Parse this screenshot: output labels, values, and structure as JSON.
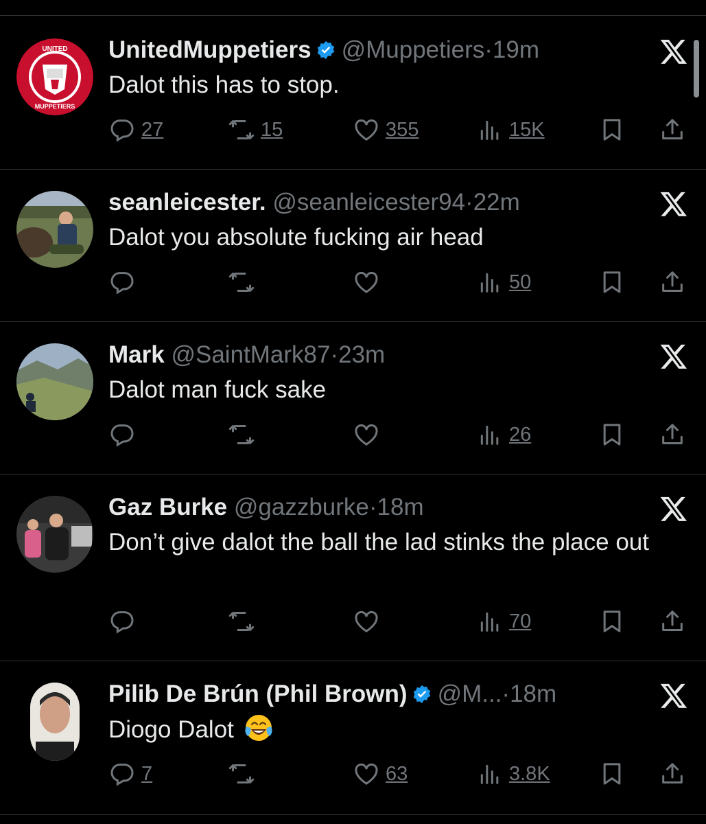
{
  "colors": {
    "background": "#000000",
    "text": "#e7e9ea",
    "muted": "#71767b",
    "verified": "#1d9bf0",
    "divider": "#2f3336"
  },
  "tweets": [
    {
      "name": "UnitedMuppetiers",
      "verified": true,
      "handle": "@Muppetiers",
      "dot": "·",
      "time": "19m",
      "text": "Dalot this has to stop.",
      "reply_count": "27",
      "retweet_count": "15",
      "like_count": "355",
      "view_count": "15K",
      "avatar_text_top": "UNITED",
      "avatar_text_bottom": "MUPPETIERS"
    },
    {
      "name": "seanleicester.",
      "verified": false,
      "handle": "@seanleicester94",
      "dot": "·",
      "time": "22m",
      "text": "Dalot you absolute fucking air head",
      "reply_count": "",
      "retweet_count": "",
      "like_count": "",
      "view_count": "50"
    },
    {
      "name": "Mark",
      "verified": false,
      "handle": "@SaintMark87",
      "dot": "·",
      "time": "23m",
      "text": "Dalot man fuck sake",
      "reply_count": "",
      "retweet_count": "",
      "like_count": "",
      "view_count": "26"
    },
    {
      "name": "Gaz Burke",
      "verified": false,
      "handle": "@gazzburke",
      "dot": "·",
      "time": "18m",
      "text": "Don’t give dalot the ball the lad stinks the place out",
      "reply_count": "",
      "retweet_count": "",
      "like_count": "",
      "view_count": "70"
    },
    {
      "name": "Pilib De Brún (Phil Brown)",
      "verified": true,
      "handle": "@M...",
      "dot": "·",
      "time": "18m",
      "text": "Diogo Dalot",
      "emoji": "face-with-tears-of-joy",
      "reply_count": "7",
      "retweet_count": "",
      "like_count": "63",
      "view_count": "3.8K"
    }
  ],
  "icons": [
    "x-logo-icon",
    "verified-badge-icon",
    "reply-icon",
    "retweet-icon",
    "like-icon",
    "views-icon",
    "bookmark-icon",
    "share-icon"
  ]
}
